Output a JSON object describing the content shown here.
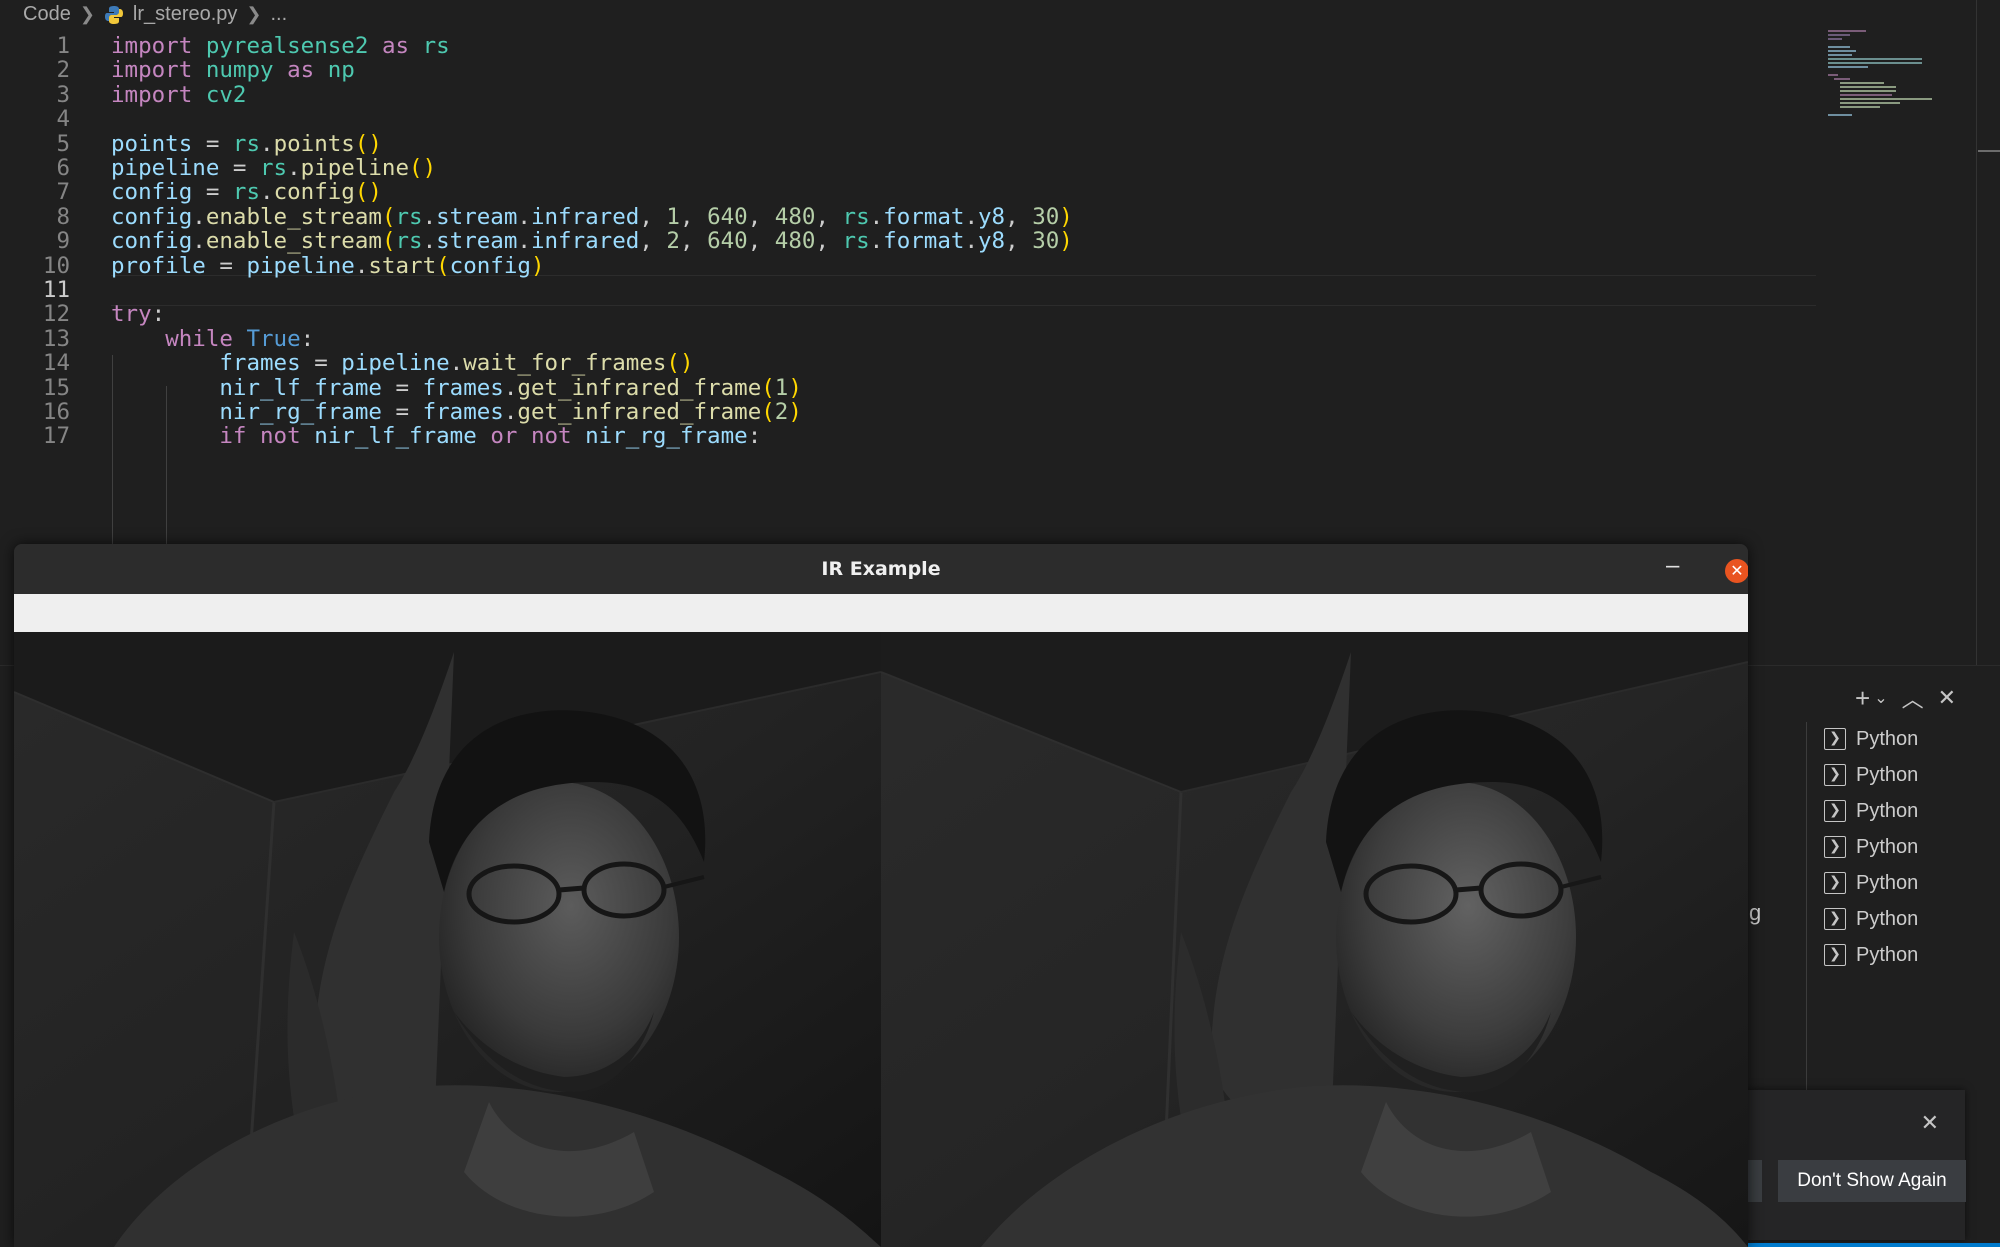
{
  "breadcrumb": {
    "root": "Code",
    "file": "lr_stereo.py",
    "more": "..."
  },
  "editor": {
    "active_line": "11",
    "lines": [
      {
        "n": "1"
      },
      {
        "n": "2"
      },
      {
        "n": "3"
      },
      {
        "n": "4"
      },
      {
        "n": "5"
      },
      {
        "n": "6"
      },
      {
        "n": "7"
      },
      {
        "n": "8"
      },
      {
        "n": "9"
      },
      {
        "n": "10"
      },
      {
        "n": "11"
      },
      {
        "n": "12"
      },
      {
        "n": "13"
      },
      {
        "n": "14"
      },
      {
        "n": "15"
      },
      {
        "n": "16"
      },
      {
        "n": "17"
      }
    ],
    "code": [
      "import pyrealsense2 as rs",
      "import numpy as np",
      "import cv2",
      "",
      "points = rs.points()",
      "pipeline = rs.pipeline()",
      "config = rs.config()",
      "config.enable_stream(rs.stream.infrared, 1, 640, 480, rs.format.y8, 30)",
      "config.enable_stream(rs.stream.infrared, 2, 640, 480, rs.format.y8, 30)",
      "profile = pipeline.start(config)",
      "",
      "try:",
      "    while True:",
      "        frames = pipeline.wait_for_frames()",
      "        nir_lf_frame = frames.get_infrared_frame(1)",
      "        nir_rg_frame = frames.get_infrared_frame(2)",
      "        if not nir_lf_frame or not nir_rg_frame:"
    ]
  },
  "panel": {
    "terminals": [
      "Python",
      "Python",
      "Python",
      "Python",
      "Python",
      "Python",
      "Python"
    ],
    "partial_text": "g"
  },
  "notification": {
    "button_label": "Don't Show Again"
  },
  "ir_window": {
    "title": "IR Example",
    "minimize_glyph": "–",
    "close_glyph": "✕"
  },
  "colors": {
    "editor_bg": "#1f1f1f",
    "keyword": "#c586c0",
    "module": "#4ec9b0",
    "number": "#b5cea8",
    "constant": "#569cd6",
    "variable": "#9cdcfe",
    "function": "#dcdcaa",
    "bracket": "#ffd700",
    "close_button": "#e95420",
    "accent": "#007acc"
  }
}
